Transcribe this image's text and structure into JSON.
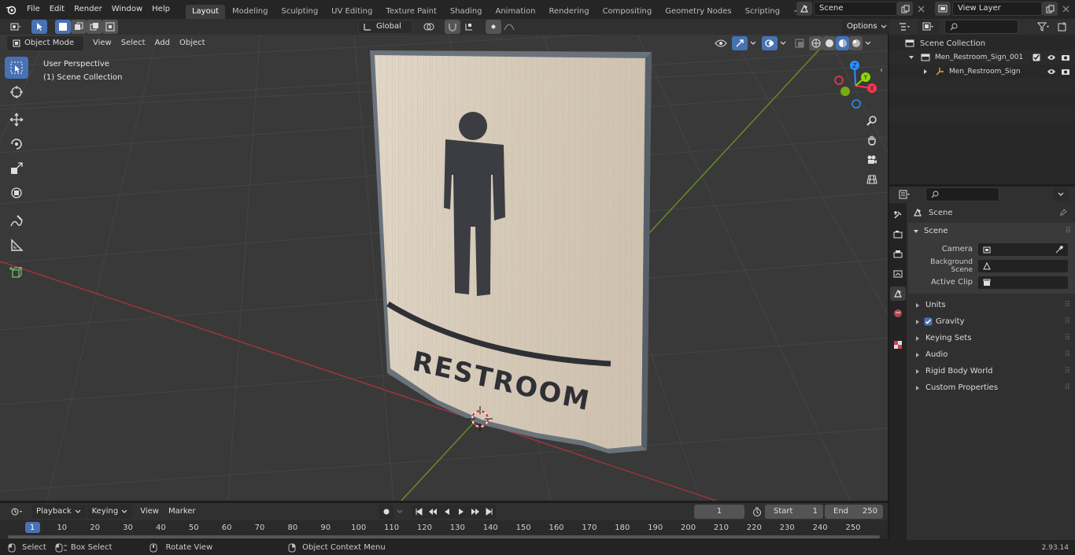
{
  "topbar": {
    "menus": [
      "File",
      "Edit",
      "Render",
      "Window",
      "Help"
    ],
    "workspaces": [
      "Layout",
      "Modeling",
      "Sculpting",
      "UV Editing",
      "Texture Paint",
      "Shading",
      "Animation",
      "Rendering",
      "Compositing",
      "Geometry Nodes",
      "Scripting"
    ],
    "active_workspace": "Layout",
    "add_tab": "+",
    "scene_name": "Scene",
    "view_layer": "View Layer"
  },
  "viewport": {
    "transform_orientation": "Global",
    "options_label": "Options",
    "mode": "Object Mode",
    "header_menus": [
      "View",
      "Select",
      "Add",
      "Object"
    ],
    "perspective_label": "User Perspective",
    "collection_label": "(1) Scene Collection",
    "gizmo_axes": [
      "X",
      "Y",
      "Z"
    ]
  },
  "sign": {
    "text": "RESTROOM"
  },
  "outliner": {
    "root": "Scene Collection",
    "collection": "Men_Restroom_Sign_001",
    "object": "Men_Restroom_Sign"
  },
  "properties": {
    "context_title": "Scene",
    "panel_title": "Scene",
    "fields": [
      {
        "label": "Camera",
        "value": ""
      },
      {
        "label": "Background Scene",
        "value": ""
      },
      {
        "label": "Active Clip",
        "value": ""
      }
    ],
    "subpanels": [
      "Units",
      "Gravity",
      "Keying Sets",
      "Audio",
      "Rigid Body World",
      "Custom Properties"
    ]
  },
  "timeline": {
    "menus": [
      "Playback",
      "Keying",
      "View",
      "Marker"
    ],
    "current_frame": "1",
    "start_label": "Start",
    "start_value": "1",
    "end_label": "End",
    "end_value": "250",
    "ticks": [
      "1",
      "10",
      "20",
      "30",
      "40",
      "50",
      "60",
      "70",
      "80",
      "90",
      "100",
      "110",
      "120",
      "130",
      "140",
      "150",
      "160",
      "170",
      "180",
      "190",
      "200",
      "210",
      "220",
      "230",
      "240",
      "250"
    ]
  },
  "statusbar": {
    "select": "Select",
    "box_select": "Box Select",
    "rotate_view": "Rotate View",
    "context_menu": "Object Context Menu",
    "version": "2.93.14"
  },
  "colors": {
    "accent": "#4772b3",
    "x_axis": "#ff3352",
    "y_axis": "#8bdc00",
    "z_axis": "#2890ff"
  }
}
